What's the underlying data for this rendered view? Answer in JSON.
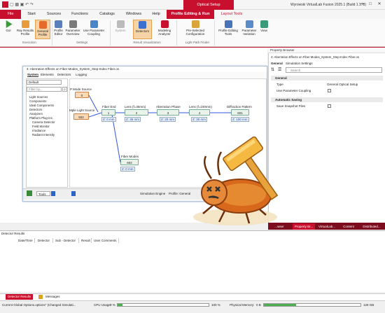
{
  "titlebar": {
    "context_tab": "Optical Setup",
    "app_title": "Wyrowski VirtualLab Fusion 2025.1 (Build 1.178)"
  },
  "tabs": [
    "File",
    "Start",
    "Sources",
    "Functions",
    "Catalogs",
    "Windows",
    "Help",
    "Profile Editing & Run",
    "Layout Tools"
  ],
  "ribbon": {
    "buttons": [
      {
        "label": "Go!"
      },
      {
        "label": "Ray Results Profile"
      },
      {
        "label": "General Profile"
      },
      {
        "label": "Profile Editor"
      },
      {
        "label": "Parameter Overview"
      },
      {
        "label": "Use Parameter Coupling"
      },
      {
        "label": "System"
      },
      {
        "label": "Detectors"
      },
      {
        "label": "Modeling Analyzer"
      },
      {
        "label": "Pre-Selected Configuration"
      },
      {
        "label": "Profile Editing Tools"
      },
      {
        "label": "Parameter Variation"
      },
      {
        "label": "View"
      }
    ],
    "groups": [
      "Execution",
      "Settings",
      "Result Visualization",
      "Light Path Finder"
    ]
  },
  "document": {
    "title": "4: Aberration Effects on Fiber Modes_System_Step-Index Fiber.os",
    "tabs": [
      "System",
      "Elements",
      "Detectors",
      "Logging"
    ],
    "filter_select": "Default",
    "filter_placeholder": "Filter by...",
    "tree": [
      "Light Sources",
      "Components",
      "Ideal Components",
      "Detectors",
      "Analyzers",
      "Platform Plug-ins",
      "Camera Detector",
      "Field Monitor",
      "Irradiance",
      "Radiant Intensity"
    ],
    "status_tools": "Tools",
    "status_engine": "Simulation Engine",
    "status_profile": "Profile: General"
  },
  "nodes": [
    {
      "label": "P Mode Source",
      "id": "0"
    },
    {
      "label": "Mple Light Source",
      "id": "502"
    },
    {
      "label": "Fiber End",
      "id": "1",
      "val": "Z: 0 mm"
    },
    {
      "label": "Lens (f=36mm)",
      "id": "2",
      "val": "Z: 36 mm"
    },
    {
      "label": "Aberration Phase",
      "id": "3",
      "val": "Z: 20 mm"
    },
    {
      "label": "Lens (f=100mm)",
      "id": "4",
      "val": "Z: 30 mm"
    },
    {
      "label": "Diffraction Pattern",
      "id": "601",
      "val": "Z: 100 mm"
    },
    {
      "label": "Fiber Modes",
      "id": "602",
      "val": "Z: 0 mm"
    }
  ],
  "property_browser": {
    "title": "Property Browser",
    "subtitle": "4: Aberration Effects on Fiber Modes_System_Step-Index Fiber.os",
    "tabs": [
      "General",
      "Simulation Settings"
    ],
    "search_placeholder": "Search",
    "section_general": "General",
    "type_label": "Type",
    "type_value": "General Optical Setup",
    "coupling_label": "Use Parameter Coupling",
    "section_autosave": "Automatic Saving",
    "snapshot_label": "Save Snapshot Files"
  },
  "right_tabs": [
    "...wser",
    "Property Br...",
    "VirtualLab...",
    "Content",
    "Distributed..."
  ],
  "detector": {
    "title": "Detector Results",
    "headers": [
      "Date/Time",
      "Detector",
      "Sub - Detector",
      "Result",
      "User Comments"
    ]
  },
  "bottom_tabs": [
    "Detector Results",
    "Messages"
  ],
  "status": {
    "message": "Current Global Options.options\" (Changed Simulati...",
    "cpu_label": "CPU Usage:",
    "cpu_left": "0 %",
    "cpu_right": "100 %",
    "cpu_fraction": 0.05,
    "mem_label": "Physical Memory:",
    "mem_left": "0 B",
    "mem_right": "128 GB",
    "mem_fraction": 0.33
  },
  "colors": {
    "accent": "#c8102e",
    "node_blue": "#3355dd"
  }
}
